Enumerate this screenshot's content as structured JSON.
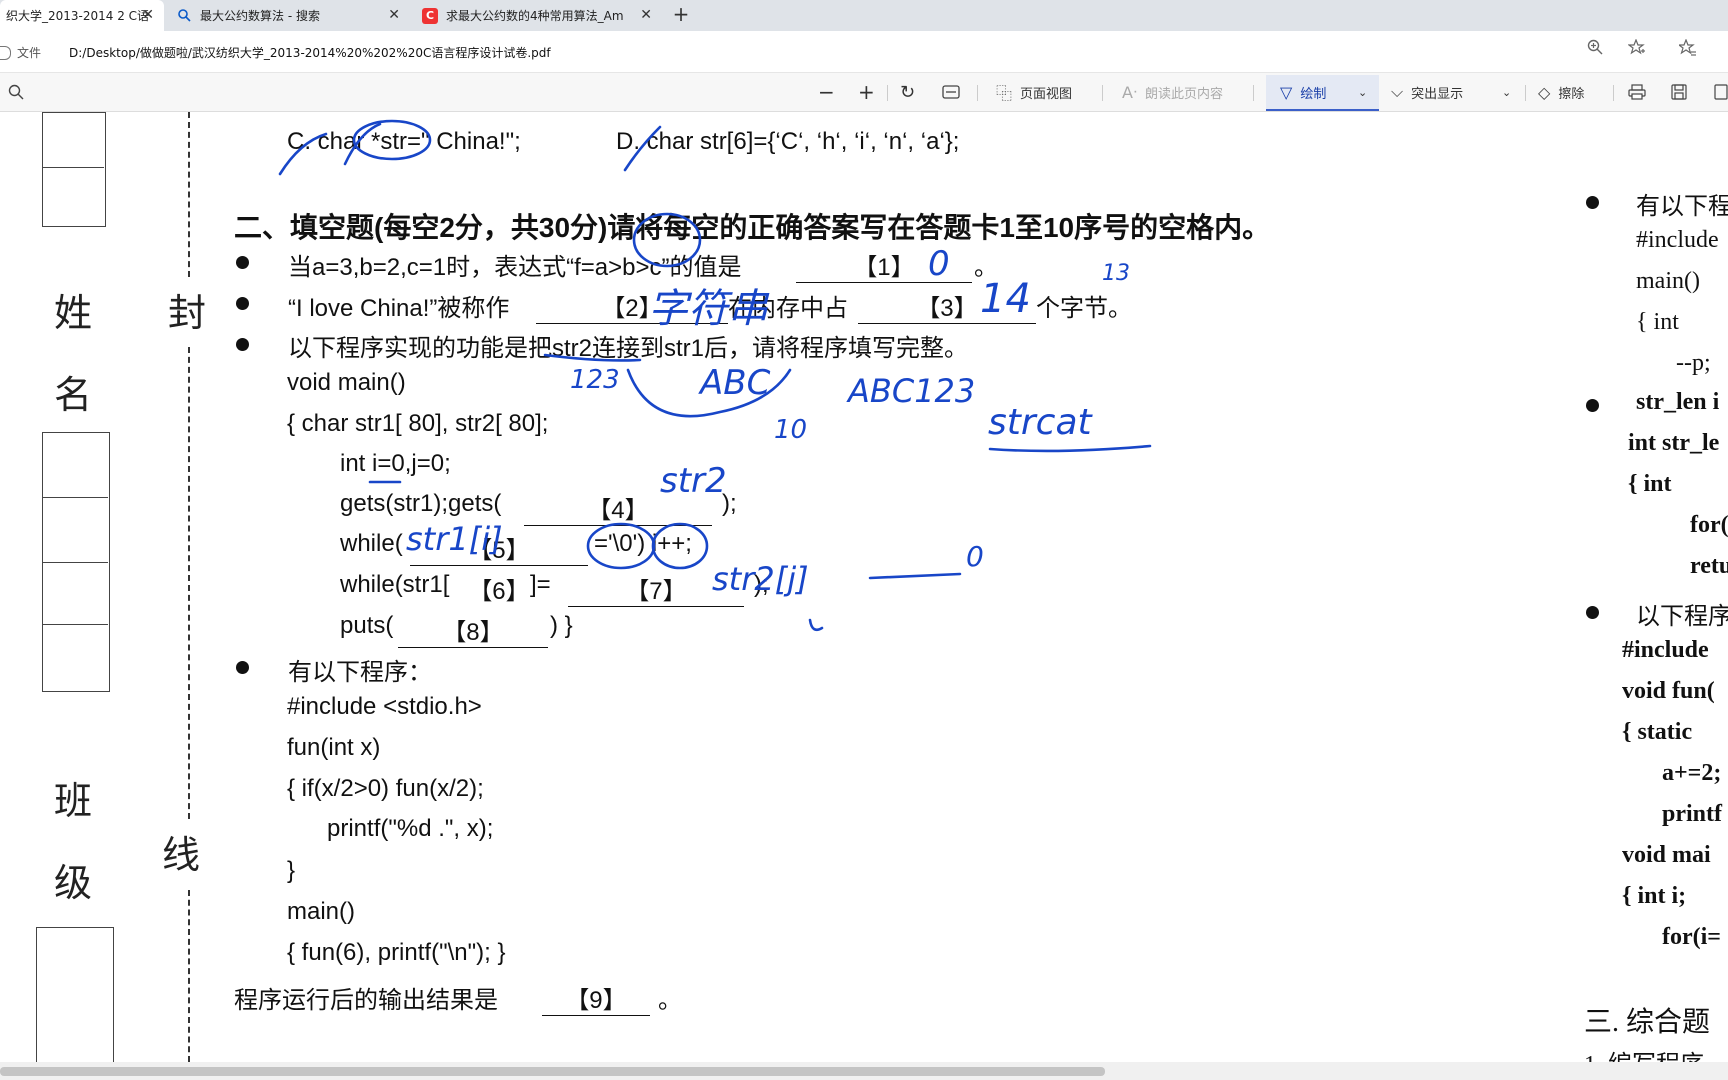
{
  "tabs": [
    {
      "title": "织大学_2013-2014 2 C语",
      "icon": "pdf-icon",
      "active": true
    },
    {
      "title": "最大公约数算法 - 搜索",
      "icon": "search-icon",
      "active": false
    },
    {
      "title": "求最大公约数的4种常用算法_Am",
      "icon": "csdn-icon",
      "active": false
    }
  ],
  "addr": {
    "file_label": "文件",
    "url": "D:/Desktop/做做题啦/武汉纺织大学_2013-2014%20%202%20C语言程序设计试卷.pdf"
  },
  "toolbar": {
    "page_view": "页面视图",
    "read_aloud": "朗读此页内容",
    "draw": "绘制",
    "highlight": "突出显示",
    "erase": "擦除"
  },
  "doc": {
    "prev_line_c": "C. char *str=\" China!\";",
    "prev_line_d": "D. char str[6]={‘C‘, ‘h‘, ‘i‘, ‘n‘, ‘a‘};",
    "section_title": "二、填空题(每空2分，共30分)请将每空的正确答案写在答题卡1至10序号的空格内。",
    "q1": "当a=3,b=2,c=1时，表达式“f=a>b>c”的值是",
    "q1_blank": "【1】",
    "q2_a": "“I love China!”被称作",
    "q2_blank2": "【2】",
    "q2_b": "在内存中占",
    "q2_blank3": "【3】",
    "q2_c": "个字节。",
    "q3": "以下程序实现的功能是把str2连接到str1后，请将程序填写完整。",
    "code1": [
      "void main()",
      "{     char str1[ 80], str2[ 80];",
      "int i=0,j=0;",
      "gets(str1);gets(",
      "while(",
      "while(str1[",
      "puts("
    ],
    "blank4": "【4】",
    "blank5": "【5】",
    "blank5_after": "='\\0') i++;",
    "blank6": "【6】",
    "blank6_after": "]=",
    "blank7": "【7】",
    "blank7_after": ");",
    "blank8": "【8】",
    "blank8_after": ") }",
    "q4": "有以下程序：",
    "code2": [
      "#include <stdio.h>",
      "fun(int x)",
      "{    if(x/2>0) fun(x/2);",
      "printf(\"%d   .\", x);",
      "}",
      "main()",
      "{     fun(6), printf(\"\\n\");  }"
    ],
    "q4_result": "程序运行后的输出结果是",
    "blank9": "【9】",
    "period": "。",
    "side": [
      "姓",
      "名",
      "班",
      "级",
      "封",
      "线"
    ],
    "right_col": [
      "有以下程",
      "#include",
      "main()",
      "{   int",
      "--p;",
      "str_len i",
      "int str_le",
      "{     int",
      "for(",
      "retu",
      "以下程序",
      "#include",
      "void fun(",
      "{    static",
      "a+=2;",
      "printf",
      "void mai",
      "{   int i;",
      "for(i=",
      "三. 综合题",
      "1. 编写程序"
    ]
  },
  "annotations": {
    "a1": "0",
    "a2": "字符串",
    "a3": "14",
    "a3b": "13",
    "h_123": "123",
    "h_abc": "ABC",
    "h_abc123": "ABC123",
    "h_10": "10",
    "h_strcat": "strcat",
    "h_str2": "str2",
    "h_str1i": "str1[i]",
    "h_str2j": "str2[j]",
    "h_zero": "0"
  }
}
